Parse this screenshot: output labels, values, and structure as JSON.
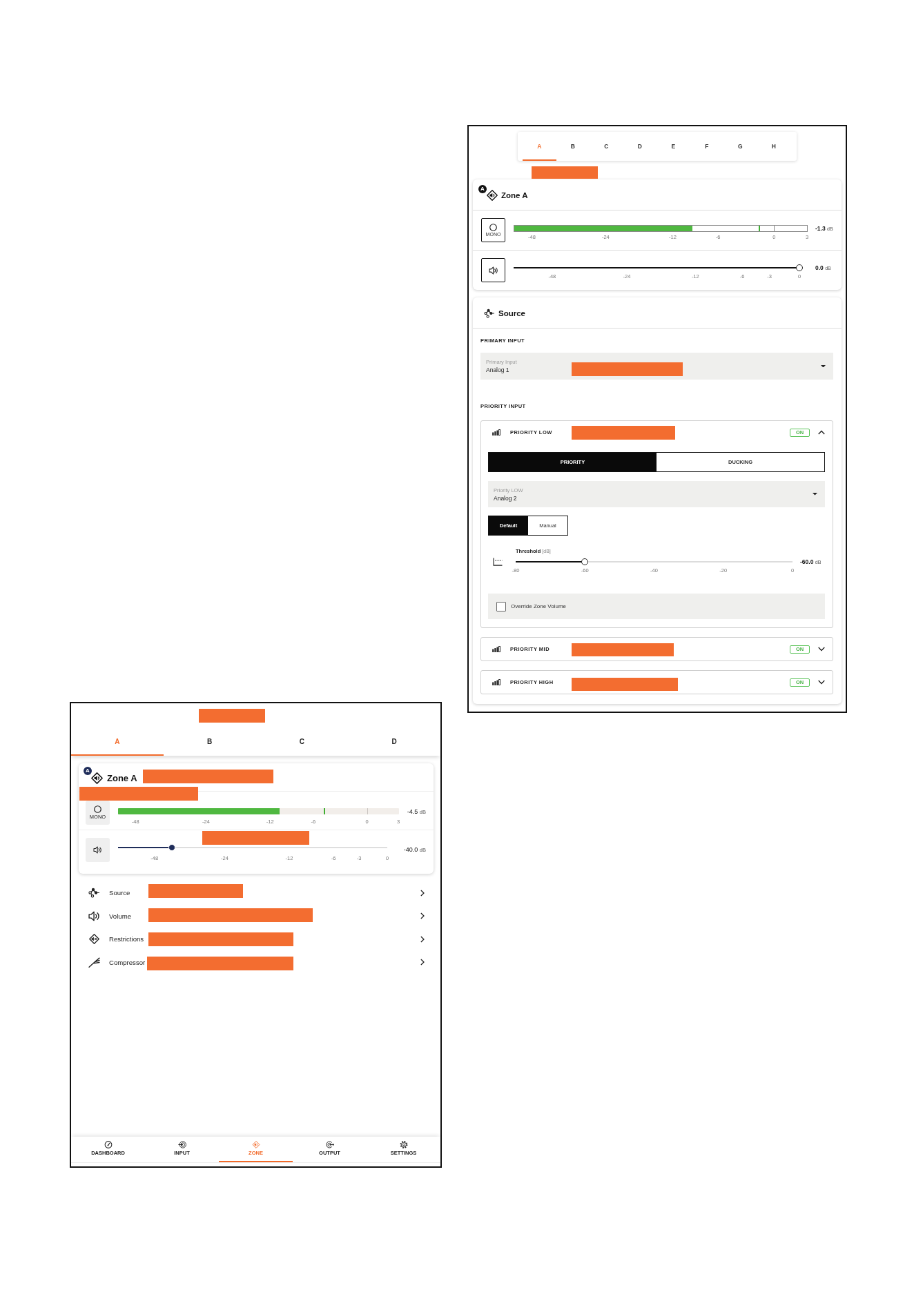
{
  "desktop_view": {
    "zone_tabs": [
      {
        "label": "A",
        "selected": true
      },
      {
        "label": "B",
        "selected": false
      },
      {
        "label": "C",
        "selected": false
      },
      {
        "label": "D",
        "selected": false
      },
      {
        "label": "E",
        "selected": false
      },
      {
        "label": "F",
        "selected": false
      },
      {
        "label": "G",
        "selected": false
      },
      {
        "label": "H",
        "selected": false
      }
    ],
    "zone_card": {
      "badge": "A",
      "title": "Zone A",
      "output_meter": {
        "mode_label": "MONO",
        "level": 0.608,
        "peak": {
          "level": 0.838
        },
        "scale": [
          "-48",
          "-24",
          "-12",
          "-6",
          "0",
          "3"
        ],
        "reading": "-1.3",
        "unit": "dB"
      },
      "volume": {
        "level": 1,
        "scale": [
          "-48",
          "-24",
          "-12",
          "-6",
          "-3",
          "0"
        ],
        "reading": "0.0",
        "unit": "dB"
      }
    },
    "source_card": {
      "title": "Source",
      "primary_input": {
        "heading": "PRIMARY INPUT",
        "dropdown": {
          "label": "Primary Input",
          "value": "Analog 1"
        }
      },
      "priority_input": {
        "heading": "PRIORITY INPUT",
        "groups": [
          {
            "title": "PRIORITY LOW",
            "status": "ON",
            "on": true,
            "expanded": true,
            "modes": [
              {
                "label": "PRIORITY",
                "selected": true
              },
              {
                "label": "DUCKING",
                "selected": false
              }
            ],
            "dropdown": {
              "label": "Priority LOW",
              "value": "Analog 2"
            },
            "threshold_modes": [
              {
                "label": "Default",
                "selected": true
              },
              {
                "label": "Manual",
                "selected": false
              }
            ],
            "threshold": {
              "label": "Threshold",
              "unit": "[dB]",
              "level": 0.25,
              "scale": [
                "-80",
                "-60",
                "-40",
                "-20",
                "0"
              ],
              "reading": "-60.0",
              "reading_unit": "dB"
            },
            "override": {
              "label": "Override Zone Volume",
              "checked": false
            }
          },
          {
            "title": "PRIORITY MID",
            "status": "ON",
            "on": true,
            "expanded": false
          },
          {
            "title": "PRIORITY HIGH",
            "status": "ON",
            "on": true,
            "expanded": false
          }
        ]
      }
    }
  },
  "tablet_view": {
    "zone_tabs": [
      {
        "label": "A",
        "selected": true
      },
      {
        "label": "B",
        "selected": false
      },
      {
        "label": "C",
        "selected": false
      },
      {
        "label": "D",
        "selected": false
      }
    ],
    "zone_card": {
      "badge": "A",
      "title": "Zone A",
      "output_meter": {
        "mode_label": "MONO",
        "level": 0.575,
        "peak": {
          "level": 0.734
        },
        "scale": [
          "-48",
          "-24",
          "-12",
          "-6",
          "0",
          "3"
        ],
        "reading": "-4.5",
        "unit": "dB"
      },
      "volume": {
        "level": 0.2,
        "scale": [
          "-48",
          "-24",
          "-12",
          "-6",
          "-3",
          "0"
        ],
        "reading": "-40.0",
        "unit": "dB"
      }
    },
    "menu": [
      {
        "label": "Source"
      },
      {
        "label": "Volume"
      },
      {
        "label": "Restrictions"
      },
      {
        "label": "Compressor"
      }
    ],
    "bottom_nav": [
      {
        "label": "DASHBOARD",
        "selected": false
      },
      {
        "label": "INPUT",
        "selected": false
      },
      {
        "label": "ZONE",
        "selected": true
      },
      {
        "label": "OUTPUT",
        "selected": false
      },
      {
        "label": "SETTINGS",
        "selected": false
      }
    ]
  }
}
